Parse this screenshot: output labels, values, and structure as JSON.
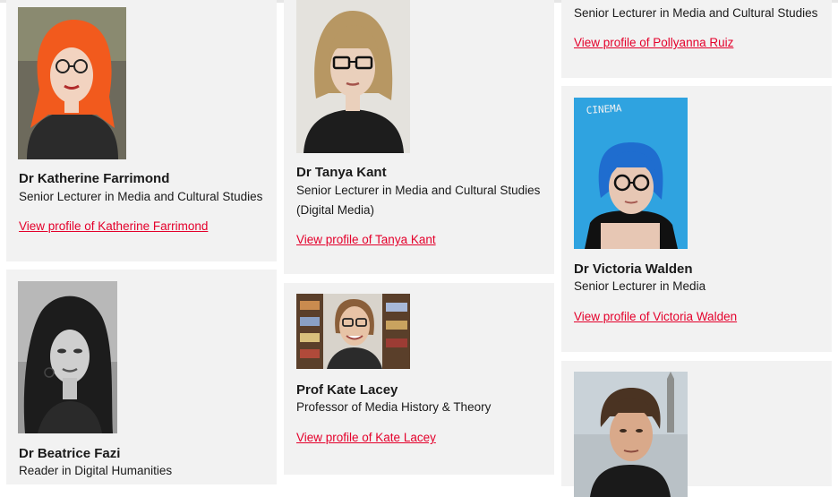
{
  "accent_color": "#e4002b",
  "card_background": "#f2f2f2",
  "people": [
    {
      "name": "Dr Katherine Farrimond",
      "role": "Senior Lecturer in Media and Cultural Studies",
      "link": "View profile of Katherine Farrimond",
      "photo": "portrait-orange-hair-glasses"
    },
    {
      "name": "Dr Beatrice Fazi",
      "role": "Reader in Digital Humanities",
      "photo": "portrait-black-and-white-curly-hair"
    },
    {
      "name": "Dr Tanya Kant",
      "role": "Senior Lecturer in Media and Cultural Studies (Digital Media)",
      "link": "View profile of Tanya Kant",
      "photo": "portrait-blonde-fringe-glasses"
    },
    {
      "name": "Prof Kate Lacey",
      "role": "Professor of Media History & Theory",
      "link": "View profile of Kate Lacey",
      "photo": "portrait-bookshelves-background"
    },
    {
      "role": "Senior Lecturer in Media and Cultural Studies",
      "link": "View profile of Pollyanna Ruiz"
    },
    {
      "name": "Dr Victoria Walden",
      "role": "Senior Lecturer in Media",
      "link": "View profile of Victoria Walden",
      "photo": "portrait-blue-hair-cinema-wall",
      "photo_text": "CINEMA"
    },
    {
      "photo": "portrait-man-outdoors-venice"
    }
  ]
}
